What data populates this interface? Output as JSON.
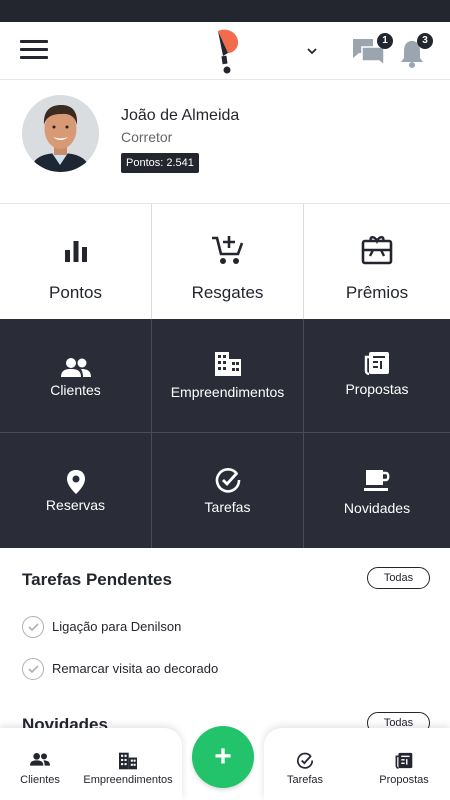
{
  "colors": {
    "dark": "#24262f",
    "tile_dark": "#2a2c37",
    "accent_green": "#22c36a",
    "logo_orange": "#f26b4d"
  },
  "header": {
    "chat_count": "1",
    "notifications_count": "3"
  },
  "profile": {
    "name": "João de Almeida",
    "role": "Corretor",
    "points": "Pontos: 2.541"
  },
  "tiles_top": [
    {
      "label": "Pontos",
      "icon": "bar-chart-icon"
    },
    {
      "label": "Resgates",
      "icon": "cart-add-icon"
    },
    {
      "label": "Prêmios",
      "icon": "gift-card-icon"
    }
  ],
  "tiles_dark": [
    {
      "label": "Clientes",
      "icon": "people-icon"
    },
    {
      "label": "Empreendimentos",
      "icon": "building-icon"
    },
    {
      "label": "Propostas",
      "icon": "document-icon"
    },
    {
      "label": "Reservas",
      "icon": "location-pin-icon"
    },
    {
      "label": "Tarefas",
      "icon": "check-circle-icon"
    },
    {
      "label": "Novidades",
      "icon": "coffee-cup-icon"
    }
  ],
  "pending": {
    "title": "Tarefas Pendentes",
    "all_label": "Todas",
    "tasks": [
      "Ligação para Denilson",
      "Remarcar visita ao decorado"
    ]
  },
  "news": {
    "title": "Novidades",
    "all_label": "Todas"
  },
  "bottom_nav": {
    "items": [
      {
        "label": "Clientes",
        "icon": "people-icon"
      },
      {
        "label": "Empreendimentos",
        "icon": "building-icon"
      },
      {
        "label": "Tarefas",
        "icon": "check-circle-icon"
      },
      {
        "label": "Propostas",
        "icon": "document-icon"
      }
    ],
    "fab_label": "+"
  }
}
